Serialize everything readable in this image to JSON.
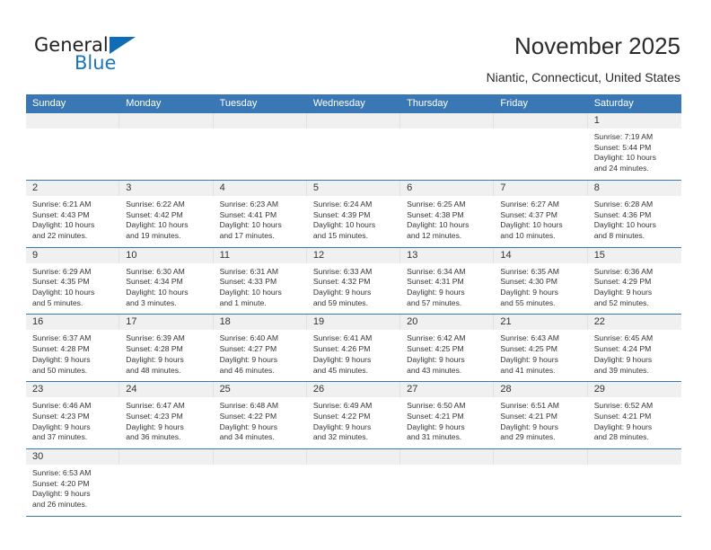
{
  "brand": {
    "name_part1": "General",
    "name_part2": "Blue",
    "accent_color": "#1b75bb",
    "triangle_icon": "logo-triangle-icon"
  },
  "header": {
    "title": "November 2025",
    "subtitle": "Niantic, Connecticut, United States"
  },
  "calendar": {
    "header_bg": "#3a78b5",
    "daynum_bg": "#f0f0f0",
    "weekday_headers": [
      "Sunday",
      "Monday",
      "Tuesday",
      "Wednesday",
      "Thursday",
      "Friday",
      "Saturday"
    ],
    "weeks": [
      [
        {
          "day": "",
          "lines": []
        },
        {
          "day": "",
          "lines": []
        },
        {
          "day": "",
          "lines": []
        },
        {
          "day": "",
          "lines": []
        },
        {
          "day": "",
          "lines": []
        },
        {
          "day": "",
          "lines": []
        },
        {
          "day": "1",
          "lines": [
            "Sunrise: 7:19 AM",
            "Sunset: 5:44 PM",
            "Daylight: 10 hours",
            "and 24 minutes."
          ]
        }
      ],
      [
        {
          "day": "2",
          "lines": [
            "Sunrise: 6:21 AM",
            "Sunset: 4:43 PM",
            "Daylight: 10 hours",
            "and 22 minutes."
          ]
        },
        {
          "day": "3",
          "lines": [
            "Sunrise: 6:22 AM",
            "Sunset: 4:42 PM",
            "Daylight: 10 hours",
            "and 19 minutes."
          ]
        },
        {
          "day": "4",
          "lines": [
            "Sunrise: 6:23 AM",
            "Sunset: 4:41 PM",
            "Daylight: 10 hours",
            "and 17 minutes."
          ]
        },
        {
          "day": "5",
          "lines": [
            "Sunrise: 6:24 AM",
            "Sunset: 4:39 PM",
            "Daylight: 10 hours",
            "and 15 minutes."
          ]
        },
        {
          "day": "6",
          "lines": [
            "Sunrise: 6:25 AM",
            "Sunset: 4:38 PM",
            "Daylight: 10 hours",
            "and 12 minutes."
          ]
        },
        {
          "day": "7",
          "lines": [
            "Sunrise: 6:27 AM",
            "Sunset: 4:37 PM",
            "Daylight: 10 hours",
            "and 10 minutes."
          ]
        },
        {
          "day": "8",
          "lines": [
            "Sunrise: 6:28 AM",
            "Sunset: 4:36 PM",
            "Daylight: 10 hours",
            "and 8 minutes."
          ]
        }
      ],
      [
        {
          "day": "9",
          "lines": [
            "Sunrise: 6:29 AM",
            "Sunset: 4:35 PM",
            "Daylight: 10 hours",
            "and 5 minutes."
          ]
        },
        {
          "day": "10",
          "lines": [
            "Sunrise: 6:30 AM",
            "Sunset: 4:34 PM",
            "Daylight: 10 hours",
            "and 3 minutes."
          ]
        },
        {
          "day": "11",
          "lines": [
            "Sunrise: 6:31 AM",
            "Sunset: 4:33 PM",
            "Daylight: 10 hours",
            "and 1 minute."
          ]
        },
        {
          "day": "12",
          "lines": [
            "Sunrise: 6:33 AM",
            "Sunset: 4:32 PM",
            "Daylight: 9 hours",
            "and 59 minutes."
          ]
        },
        {
          "day": "13",
          "lines": [
            "Sunrise: 6:34 AM",
            "Sunset: 4:31 PM",
            "Daylight: 9 hours",
            "and 57 minutes."
          ]
        },
        {
          "day": "14",
          "lines": [
            "Sunrise: 6:35 AM",
            "Sunset: 4:30 PM",
            "Daylight: 9 hours",
            "and 55 minutes."
          ]
        },
        {
          "day": "15",
          "lines": [
            "Sunrise: 6:36 AM",
            "Sunset: 4:29 PM",
            "Daylight: 9 hours",
            "and 52 minutes."
          ]
        }
      ],
      [
        {
          "day": "16",
          "lines": [
            "Sunrise: 6:37 AM",
            "Sunset: 4:28 PM",
            "Daylight: 9 hours",
            "and 50 minutes."
          ]
        },
        {
          "day": "17",
          "lines": [
            "Sunrise: 6:39 AM",
            "Sunset: 4:28 PM",
            "Daylight: 9 hours",
            "and 48 minutes."
          ]
        },
        {
          "day": "18",
          "lines": [
            "Sunrise: 6:40 AM",
            "Sunset: 4:27 PM",
            "Daylight: 9 hours",
            "and 46 minutes."
          ]
        },
        {
          "day": "19",
          "lines": [
            "Sunrise: 6:41 AM",
            "Sunset: 4:26 PM",
            "Daylight: 9 hours",
            "and 45 minutes."
          ]
        },
        {
          "day": "20",
          "lines": [
            "Sunrise: 6:42 AM",
            "Sunset: 4:25 PM",
            "Daylight: 9 hours",
            "and 43 minutes."
          ]
        },
        {
          "day": "21",
          "lines": [
            "Sunrise: 6:43 AM",
            "Sunset: 4:25 PM",
            "Daylight: 9 hours",
            "and 41 minutes."
          ]
        },
        {
          "day": "22",
          "lines": [
            "Sunrise: 6:45 AM",
            "Sunset: 4:24 PM",
            "Daylight: 9 hours",
            "and 39 minutes."
          ]
        }
      ],
      [
        {
          "day": "23",
          "lines": [
            "Sunrise: 6:46 AM",
            "Sunset: 4:23 PM",
            "Daylight: 9 hours",
            "and 37 minutes."
          ]
        },
        {
          "day": "24",
          "lines": [
            "Sunrise: 6:47 AM",
            "Sunset: 4:23 PM",
            "Daylight: 9 hours",
            "and 36 minutes."
          ]
        },
        {
          "day": "25",
          "lines": [
            "Sunrise: 6:48 AM",
            "Sunset: 4:22 PM",
            "Daylight: 9 hours",
            "and 34 minutes."
          ]
        },
        {
          "day": "26",
          "lines": [
            "Sunrise: 6:49 AM",
            "Sunset: 4:22 PM",
            "Daylight: 9 hours",
            "and 32 minutes."
          ]
        },
        {
          "day": "27",
          "lines": [
            "Sunrise: 6:50 AM",
            "Sunset: 4:21 PM",
            "Daylight: 9 hours",
            "and 31 minutes."
          ]
        },
        {
          "day": "28",
          "lines": [
            "Sunrise: 6:51 AM",
            "Sunset: 4:21 PM",
            "Daylight: 9 hours",
            "and 29 minutes."
          ]
        },
        {
          "day": "29",
          "lines": [
            "Sunrise: 6:52 AM",
            "Sunset: 4:21 PM",
            "Daylight: 9 hours",
            "and 28 minutes."
          ]
        }
      ],
      [
        {
          "day": "30",
          "lines": [
            "Sunrise: 6:53 AM",
            "Sunset: 4:20 PM",
            "Daylight: 9 hours",
            "and 26 minutes."
          ]
        },
        {
          "day": "",
          "lines": []
        },
        {
          "day": "",
          "lines": []
        },
        {
          "day": "",
          "lines": []
        },
        {
          "day": "",
          "lines": []
        },
        {
          "day": "",
          "lines": []
        },
        {
          "day": "",
          "lines": []
        }
      ]
    ]
  }
}
